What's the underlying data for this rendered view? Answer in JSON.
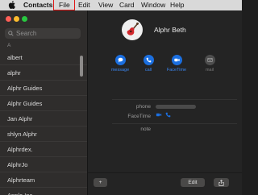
{
  "menubar": {
    "app_name": "Contacts",
    "items": [
      "File",
      "Edit",
      "View",
      "Card",
      "Window",
      "Help"
    ],
    "highlighted": "File"
  },
  "sidebar": {
    "search_placeholder": "Search",
    "section_letter": "A",
    "contacts": [
      "albert",
      "alphr",
      "Alphr Guides",
      "Alphr Guides",
      "Jan Alphr",
      "shlyn Alphr",
      "Alphrdex.",
      "AlphrJo",
      "Alphrteam",
      "Apple Inc."
    ]
  },
  "card": {
    "name": "Alphr Beth",
    "actions": [
      {
        "label": "message",
        "icon": "message-bubble-icon",
        "enabled": true
      },
      {
        "label": "call",
        "icon": "phone-icon",
        "enabled": true
      },
      {
        "label": "FaceTime",
        "icon": "video-camera-icon",
        "enabled": true
      },
      {
        "label": "mail",
        "icon": "envelope-icon",
        "enabled": false
      }
    ],
    "fields": [
      {
        "label": "phone"
      },
      {
        "label": "FaceTime"
      },
      {
        "label": "note"
      }
    ]
  },
  "bottom_bar": {
    "add_label": "+",
    "edit_label": "Edit"
  },
  "colors": {
    "accent": "#1b6fe0",
    "highlight_box": "#e01818",
    "traffic_close": "#ff5f57",
    "traffic_min": "#febc2e",
    "traffic_max": "#28c840"
  }
}
